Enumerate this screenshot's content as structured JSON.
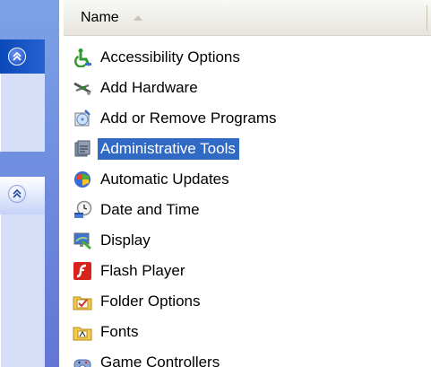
{
  "column_header": {
    "name_label": "Name",
    "sort": "ascending"
  },
  "items": [
    {
      "label": "Accessibility Options",
      "icon": "accessibility-icon"
    },
    {
      "label": "Add Hardware",
      "icon": "add-hardware-icon"
    },
    {
      "label": "Add or Remove Programs",
      "icon": "add-remove-programs-icon"
    },
    {
      "label": "Administrative Tools",
      "icon": "administrative-tools-icon",
      "selected": true
    },
    {
      "label": "Automatic Updates",
      "icon": "automatic-updates-icon"
    },
    {
      "label": "Date and Time",
      "icon": "date-time-icon"
    },
    {
      "label": "Display",
      "icon": "display-icon"
    },
    {
      "label": "Flash Player",
      "icon": "flash-player-icon"
    },
    {
      "label": "Folder Options",
      "icon": "folder-options-icon"
    },
    {
      "label": "Fonts",
      "icon": "fonts-icon"
    },
    {
      "label": "Game Controllers",
      "icon": "game-controllers-icon"
    }
  ],
  "colors": {
    "selection": "#316ac5",
    "task_pane": "#6375d6"
  }
}
